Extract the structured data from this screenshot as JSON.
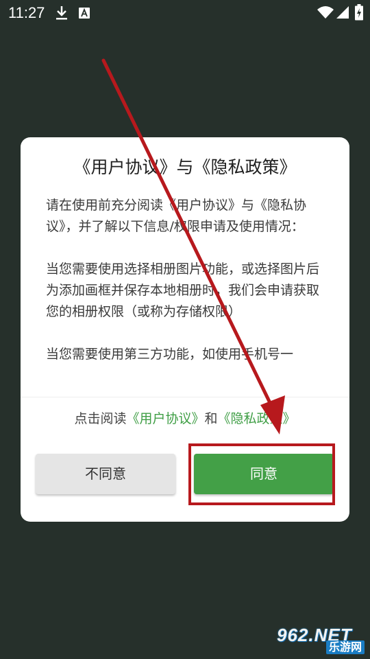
{
  "status_bar": {
    "time": "11:27",
    "icons": [
      "download-icon",
      "keyboard-a-icon",
      "wifi-icon",
      "signal-icon",
      "battery-charging-icon"
    ]
  },
  "dialog": {
    "title": "《用户协议》与《隐私政策》",
    "body_paragraphs": [
      "请在使用前充分阅读《用户协议》与《隐私协议》，并了解以下信息/权限申请及使用情况：",
      "当您需要使用选择相册图片功能，或选择图片后为添加画框并保存本地相册时，我们会申请获取您的相册权限（或称为存储权限）",
      "当您需要使用第三方功能，如使用手机号一"
    ],
    "agreement": {
      "prefix": "点击阅读",
      "user_agreement_link": "《用户协议》",
      "conjunction": "和",
      "privacy_policy_link": "《隐私政策》"
    },
    "buttons": {
      "disagree_label": "不同意",
      "agree_label": "同意"
    }
  },
  "watermark": {
    "main": "962.NET",
    "sub": "乐游网"
  },
  "colors": {
    "background": "#26302b",
    "dialog": "#ffffff",
    "accent_green": "#43a047",
    "link_green": "#3f9e45",
    "annotation_red": "#b7191d"
  }
}
